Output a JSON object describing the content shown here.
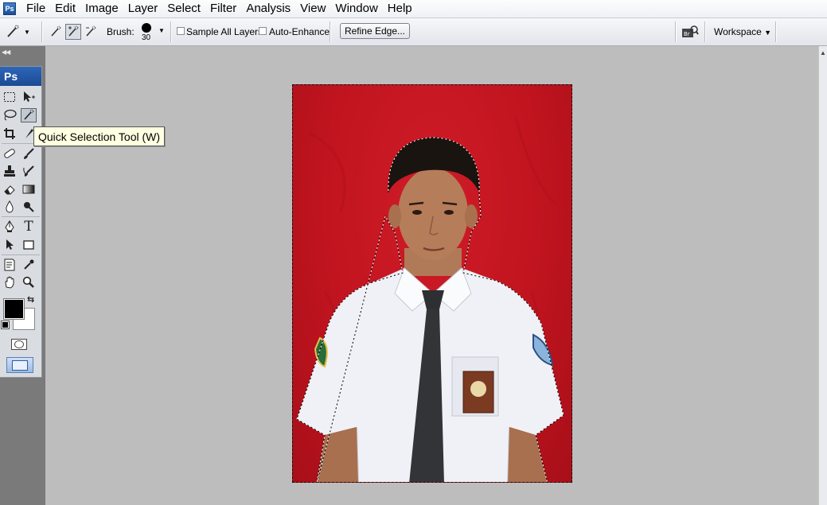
{
  "app": {
    "badge": "Ps"
  },
  "menu": [
    "File",
    "Edit",
    "Image",
    "Layer",
    "Select",
    "Filter",
    "Analysis",
    "View",
    "Window",
    "Help"
  ],
  "options": {
    "brush_label": "Brush:",
    "brush_size": "30",
    "sample_all_layers": "Sample All Layers",
    "auto_enhance": "Auto-Enhance",
    "refine_edge": "Refine Edge...",
    "workspace": "Workspace"
  },
  "toolbox": {
    "header": "Ps"
  },
  "tooltip": "Quick Selection Tool (W)",
  "colors": {
    "foreground": "#000000",
    "background": "#ffffff",
    "backdrop": "#c0141f"
  },
  "icons": [
    "quick-selection-icon",
    "marquee-icon",
    "move-icon",
    "lasso-icon",
    "crop-icon",
    "slice-icon",
    "healing-brush-icon",
    "brush-icon",
    "clone-stamp-icon",
    "history-brush-icon",
    "eraser-icon",
    "gradient-icon",
    "blur-icon",
    "dodge-icon",
    "pen-icon",
    "type-icon",
    "path-selection-icon",
    "shape-icon",
    "notes-icon",
    "eyedropper-icon",
    "hand-icon",
    "zoom-icon",
    "bridge-icon"
  ]
}
